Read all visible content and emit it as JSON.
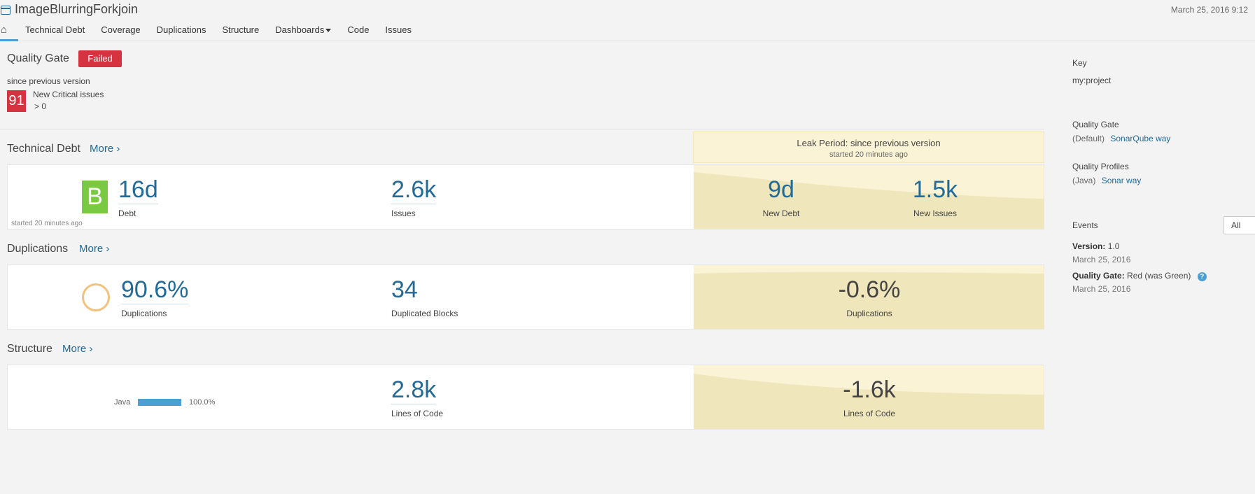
{
  "header": {
    "project_title": "ImageBlurringForkjoin",
    "date": "March 25, 2016 9:12",
    "nav": [
      "Technical Debt",
      "Coverage",
      "Duplications",
      "Structure",
      "Dashboards",
      "Code",
      "Issues"
    ]
  },
  "quality_gate": {
    "title": "Quality Gate",
    "status": "Failed",
    "since": "since previous version",
    "count": "91",
    "condition_label": "New Critical issues",
    "condition_op": "> 0"
  },
  "leak_period": {
    "title": "Leak Period: since previous version",
    "subtitle": "started 20 minutes ago"
  },
  "technical_debt": {
    "title": "Technical Debt",
    "more": "More ›",
    "rating": "B",
    "debt_value": "16d",
    "debt_label": "Debt",
    "issues_value": "2.6k",
    "issues_label": "Issues",
    "started_note": "started 20 minutes ago",
    "new_debt_value": "9d",
    "new_debt_label": "New Debt",
    "new_issues_value": "1.5k",
    "new_issues_label": "New Issues"
  },
  "duplications": {
    "title": "Duplications",
    "more": "More ›",
    "dup_value": "90.6%",
    "dup_label": "Duplications",
    "blocks_value": "34",
    "blocks_label": "Duplicated Blocks",
    "leak_value": "-0.6%",
    "leak_label": "Duplications"
  },
  "structure": {
    "title": "Structure",
    "more": "More ›",
    "lang_name": "Java",
    "lang_pct": "100.0%",
    "loc_value": "2.8k",
    "loc_label": "Lines of Code",
    "leak_value": "-1.6k",
    "leak_label": "Lines of Code"
  },
  "sidebar": {
    "key_label": "Key",
    "key_value": "my:project",
    "qg_label": "Quality Gate",
    "qg_default": "(Default)",
    "qg_link": "SonarQube way",
    "qp_label": "Quality Profiles",
    "qp_lang": "(Java)",
    "qp_link": "Sonar way",
    "events_label": "Events",
    "events_filter": "All",
    "event1_label": "Version:",
    "event1_value": "1.0",
    "event1_date": "March 25, 2016",
    "event2_label": "Quality Gate:",
    "event2_value": "Red (was Green)",
    "event2_date": "March 25, 2016"
  },
  "colors": {
    "failed": "#d4333f",
    "rating_b": "#7ac943",
    "link": "#236a97",
    "leak_bg": "#efe6bb",
    "ring": "#f1c27d"
  }
}
